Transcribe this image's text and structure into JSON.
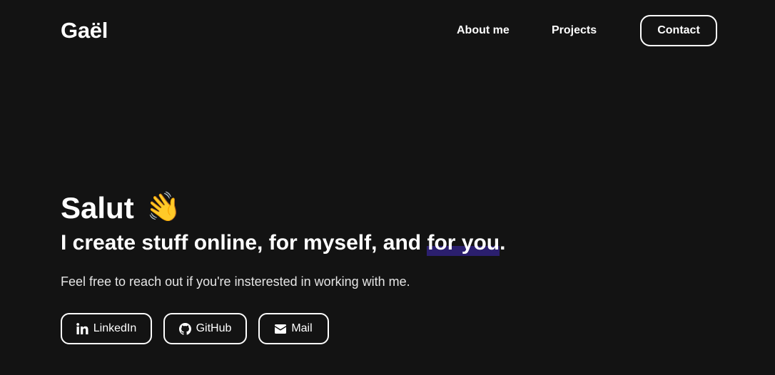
{
  "header": {
    "logo": "Gaël",
    "nav": {
      "about": "About me",
      "projects": "Projects",
      "contact": "Contact"
    }
  },
  "hero": {
    "greeting": "Salut",
    "wave_emoji": "👋",
    "subtitle_before": "I create stuff online, for myself, and ",
    "subtitle_highlight": "for you",
    "subtitle_after": ".",
    "text": "Feel free to reach out if you're insterested in working with me."
  },
  "social": {
    "linkedin": "LinkedIn",
    "github": "GitHub",
    "mail": "Mail"
  },
  "colors": {
    "background": "#131313",
    "text": "#ffffff",
    "highlight": "#2b1f6e"
  }
}
